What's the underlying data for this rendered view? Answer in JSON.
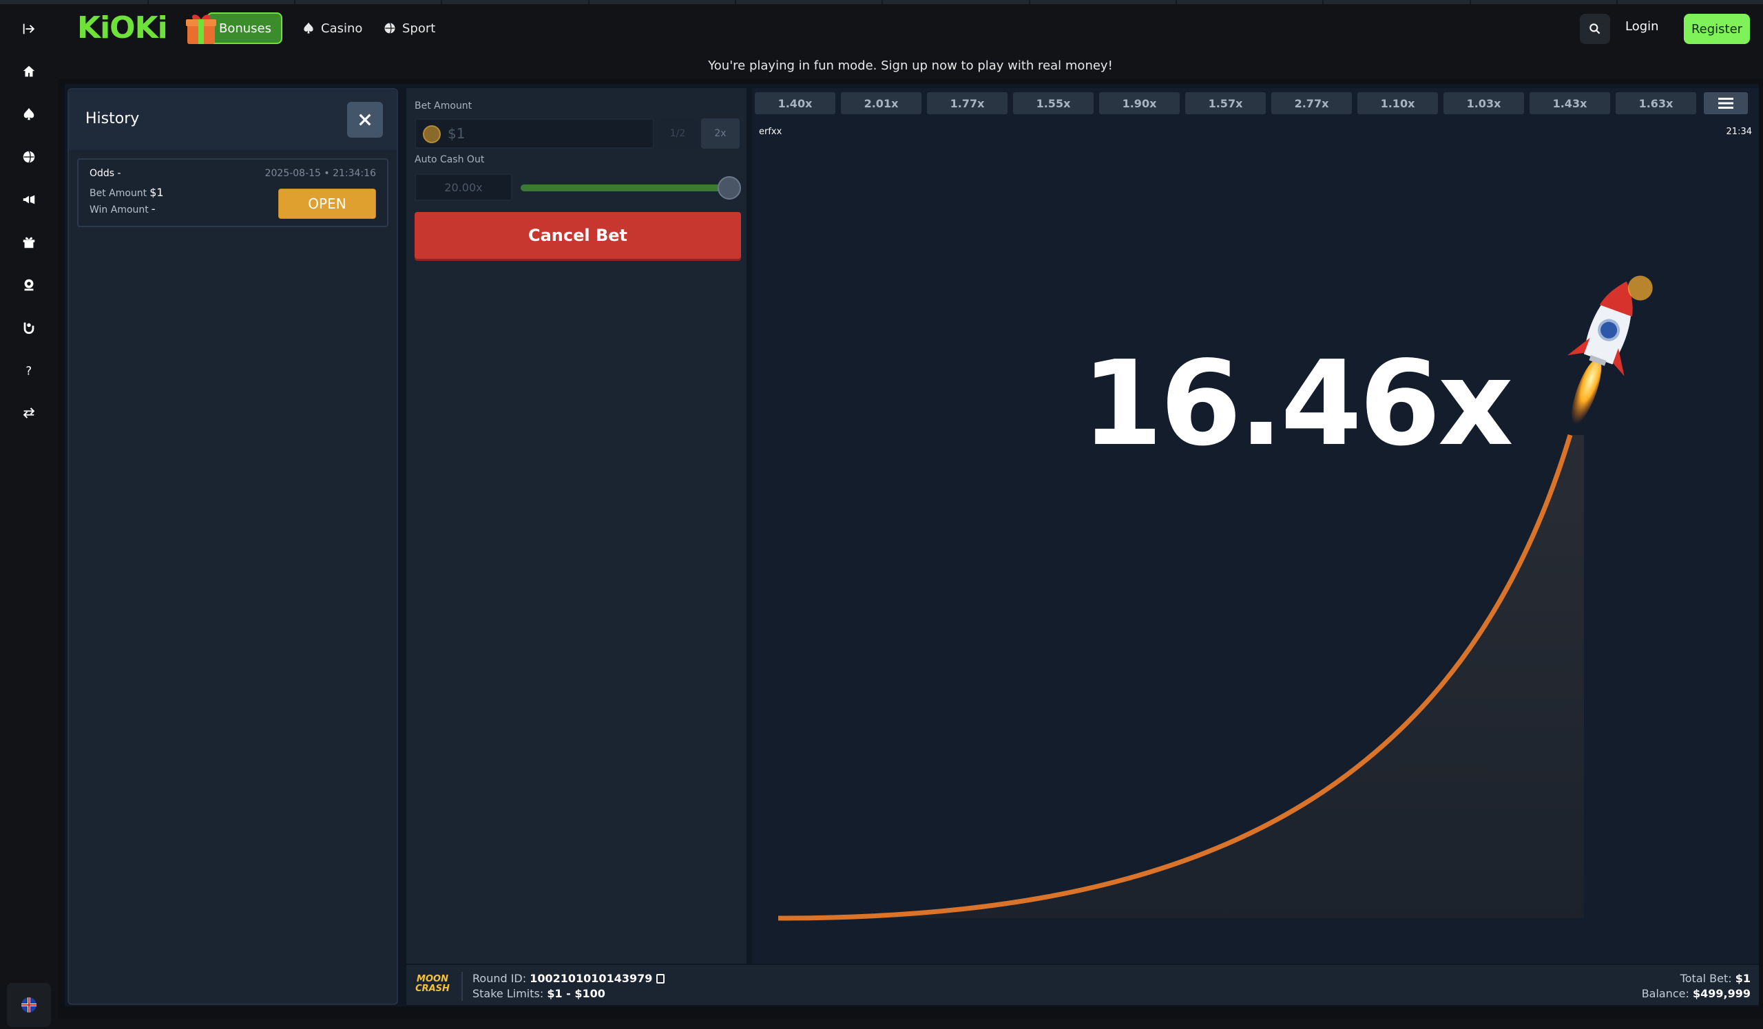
{
  "header": {
    "logo": "KiOKi",
    "bonuses": "Bonuses",
    "casino": "Casino",
    "sport": "Sport",
    "login": "Login",
    "register": "Register"
  },
  "banner": "You're playing in fun mode. Sign up now to play with real money!",
  "sidebar": {
    "icons": [
      "expand-icon",
      "home-icon",
      "spade-icon",
      "sport-ball-icon",
      "megaphone-icon",
      "gift-icon",
      "trophy-icon",
      "cashback-icon",
      "help-icon",
      "exchange-icon"
    ],
    "language": "english-flag-icon"
  },
  "history": {
    "title": "History",
    "entries": [
      {
        "odds_label": "Odds",
        "odds_value": "-",
        "bet_label": "Bet Amount",
        "bet_value": "$1",
        "win_label": "Win Amount",
        "win_value": "-",
        "date": "2025-08-15 • 21:34:16",
        "action": "OPEN"
      }
    ]
  },
  "bet": {
    "amount_label": "Bet Amount",
    "amount_value": "$1",
    "half_label": "1/2",
    "double_label": "2x",
    "autocashout_label": "Auto Cash Out",
    "autocashout_value": "20.00x",
    "autocashout_slider_fraction": 1.0,
    "cancel_label": "Cancel Bet"
  },
  "game": {
    "recent_multipliers": [
      "1.40x",
      "2.01x",
      "1.77x",
      "1.55x",
      "1.90x",
      "1.57x",
      "2.77x",
      "1.10x",
      "1.03x",
      "1.43x",
      "1.63x"
    ],
    "user": "erfxx",
    "time": "21:34",
    "current_multiplier": "16.46x",
    "curve_color": "#d9742a"
  },
  "footer": {
    "logo": "MOON CRASH",
    "round_label": "Round ID:",
    "round_value": "1002101010143979",
    "stake_label": "Stake Limits:",
    "stake_value": "$1 - $100",
    "total_bet_label": "Total Bet:",
    "total_bet_value": "$1",
    "balance_label": "Balance:",
    "balance_value": "$499,999"
  },
  "colors": {
    "accent_green": "#7ff25a",
    "cancel_red": "#c8372f",
    "open_orange": "#e0a02f"
  }
}
